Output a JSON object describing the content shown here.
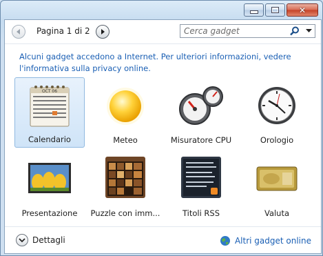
{
  "pager": {
    "label": "Pagina 1 di 2"
  },
  "search": {
    "placeholder": "Cerca gadget"
  },
  "info_text": "Alcuni gadget accedono a Internet. Per ulteriori informazioni, vedere l'informativa sulla privacy online.",
  "calendar_icon": {
    "month": "OCT 06"
  },
  "gadgets": [
    {
      "label": "Calendario",
      "icon": "calendar-icon",
      "selected": true
    },
    {
      "label": "Meteo",
      "icon": "sun-icon"
    },
    {
      "label": "Misuratore CPU",
      "icon": "cpu-meter-icon"
    },
    {
      "label": "Orologio",
      "icon": "clock-icon"
    },
    {
      "label": "Presentazione",
      "icon": "slideshow-icon"
    },
    {
      "label": "Puzzle con imm...",
      "icon": "puzzle-icon"
    },
    {
      "label": "Titoli RSS",
      "icon": "rss-icon"
    },
    {
      "label": "Valuta",
      "icon": "currency-icon"
    }
  ],
  "footer": {
    "details_label": "Dettagli",
    "online_label": "Altri gadget online"
  }
}
